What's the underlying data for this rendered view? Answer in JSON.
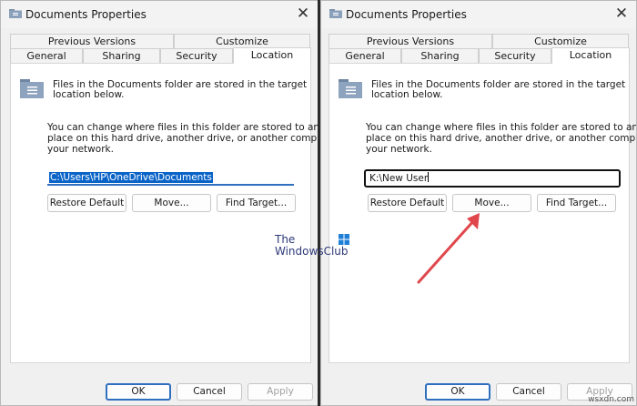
{
  "dialogs": [
    {
      "title": "Documents Properties",
      "tabs_top": [
        "Previous Versions",
        "Customize"
      ],
      "tabs_bottom": [
        "General",
        "Sharing",
        "Security",
        "Location"
      ],
      "description": [
        "Files in the Documents folder are stored in the target",
        "location below."
      ],
      "paragraph": [
        "You can change where files in this folder are stored to another",
        "place on this hard drive, another drive, or another computer on",
        "your network."
      ],
      "path_value": "C:\\Users\\HP\\OneDrive\\Documents",
      "buttons": [
        "Restore Default",
        "Move...",
        "Find Target..."
      ],
      "footer_buttons": [
        "OK",
        "Cancel",
        "Apply"
      ]
    },
    {
      "title": "Documents Properties",
      "tabs_top": [
        "Previous Versions",
        "Customize"
      ],
      "tabs_bottom": [
        "General",
        "Sharing",
        "Security",
        "Location"
      ],
      "description": [
        "Files in the Documents folder are stored in the target",
        "location below."
      ],
      "paragraph": [
        "You can change where files in this folder are stored to another",
        "place on this hard drive, another drive, or another computer on",
        "your network."
      ],
      "path_value": "K:\\New User",
      "buttons": [
        "Restore Default",
        "Move...",
        "Find Target..."
      ],
      "footer_buttons": [
        "OK",
        "Cancel",
        "Apply"
      ]
    }
  ],
  "watermark": [
    "The",
    "WindowsClub"
  ],
  "credit": "wsxdn.com",
  "colors": {
    "accent": "#2f6fbf",
    "selection": "#0a64c8",
    "arrow": "#e0474c"
  },
  "icons": [
    "folder-icon",
    "close-icon",
    "windows-logo-icon",
    "arrow-icon"
  ]
}
